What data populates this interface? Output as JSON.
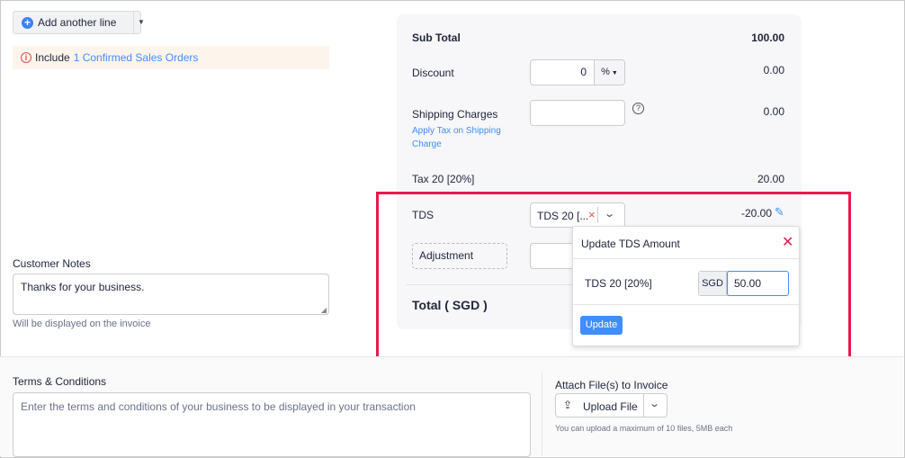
{
  "toolbar": {
    "add_line_label": "Add another line"
  },
  "include_banner": {
    "prefix": "Include",
    "link": "1 Confirmed Sales Orders"
  },
  "summary": {
    "subtotal_label": "Sub Total",
    "subtotal_value": "100.00",
    "discount_label": "Discount",
    "discount_input": "0",
    "discount_unit": "%",
    "discount_value": "0.00",
    "shipping_label": "Shipping Charges",
    "shipping_link_line1": "Apply Tax on Shipping",
    "shipping_link_line2": "Charge",
    "shipping_value": "0.00",
    "tax_label": "Tax 20 [20%]",
    "tax_value": "20.00",
    "tds_label": "TDS",
    "tds_select": "TDS 20 [...",
    "tds_value": "-20.00",
    "adjustment_label": "Adjustment",
    "total_label": "Total ( SGD )"
  },
  "tds_popup": {
    "title": "Update TDS Amount",
    "row_label": "TDS 20 [20%]",
    "currency": "SGD",
    "amount": "50.00",
    "update_button": "Update"
  },
  "customer_notes": {
    "label": "Customer Notes",
    "value": "Thanks for your business.",
    "hint": "Will be displayed on the invoice"
  },
  "terms": {
    "label": "Terms & Conditions",
    "placeholder": "Enter the terms and conditions of your business to be displayed in your transaction"
  },
  "attach": {
    "label": "Attach File(s) to Invoice",
    "upload_label": "Upload File",
    "hint": "You can upload a maximum of 10 files, 5MB each"
  },
  "colors": {
    "accent": "#408dfb",
    "highlight": "#e8194d",
    "danger": "#d9534f"
  }
}
